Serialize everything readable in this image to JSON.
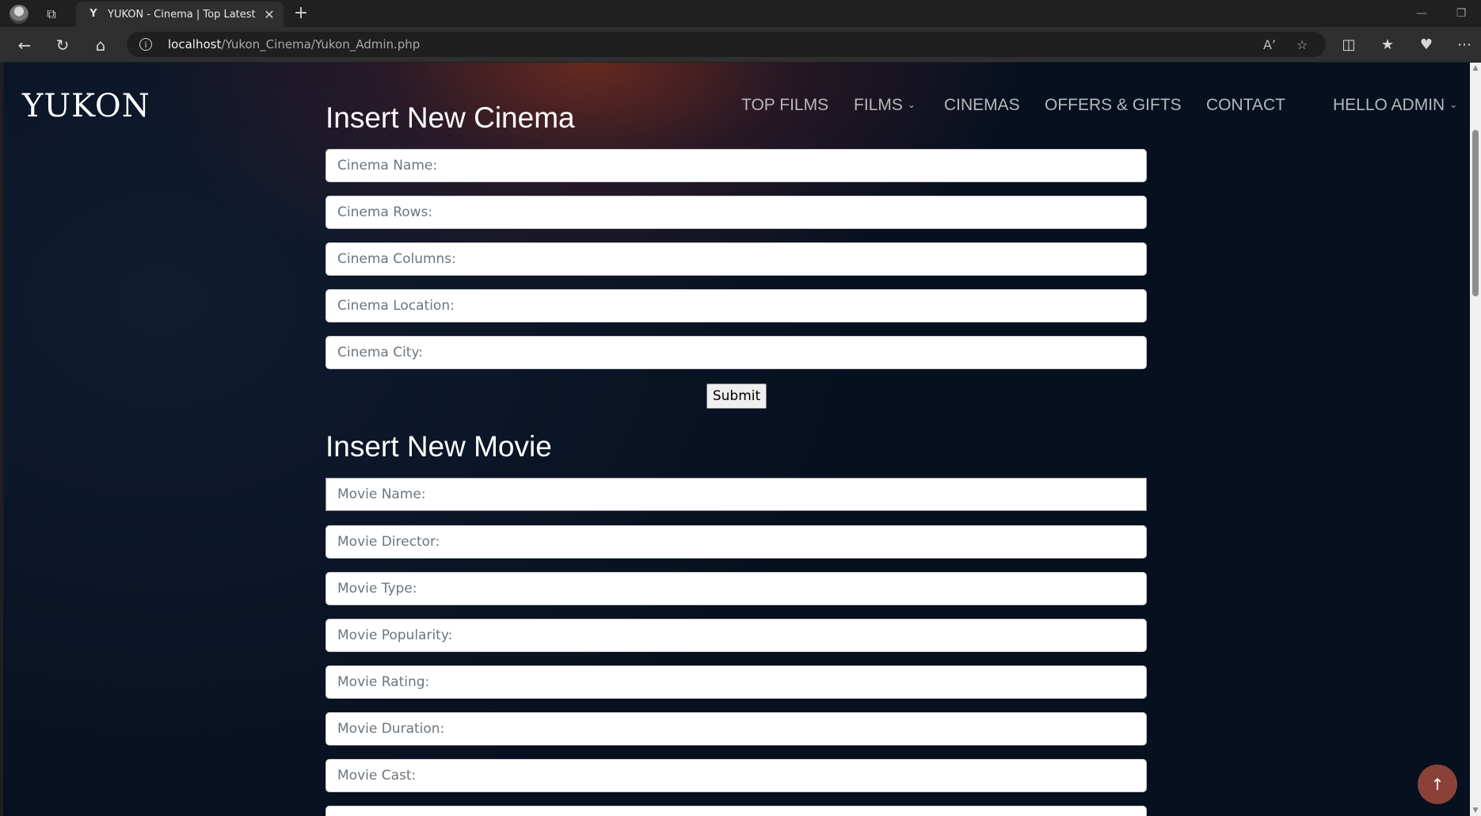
{
  "browser": {
    "tab_title": "YUKON - Cinema | Top Latest Mo",
    "tab_favicon": "Y",
    "url_host": "localhost",
    "url_path": "/Yukon_Cinema/Yukon_Admin.php",
    "icons": [
      "profile-icon",
      "workspaces-icon",
      "close-tab-icon",
      "new-tab-icon",
      "back-icon",
      "refresh-icon",
      "home-icon",
      "site-info-icon",
      "read-aloud-icon",
      "favorite-star-icon",
      "split-screen-icon",
      "favorites-icon",
      "browser-essentials-icon",
      "more-menu-icon",
      "minimize-icon",
      "restore-icon"
    ]
  },
  "site": {
    "logo": "YUKON",
    "nav": {
      "top_films": "TOP FILMS",
      "films": "FILMS",
      "cinemas": "CINEMAS",
      "offers": "OFFERS & GIFTS",
      "contact": "CONTACT",
      "user": "HELLO ADMIN"
    }
  },
  "cinema_form": {
    "title": "Insert New Cinema",
    "fields": {
      "name": "Cinema Name:",
      "rows": "Cinema Rows:",
      "columns": "Cinema Columns:",
      "location": "Cinema Location:",
      "city": "Cinema City:"
    },
    "submit_label": "Submit"
  },
  "movie_form": {
    "title": "Insert New Movie",
    "fields": {
      "name": "Movie Name:",
      "director": "Movie Director:",
      "type": "Movie Type:",
      "popularity": "Movie Popularity:",
      "rating": "Movie Rating:",
      "duration": "Movie Duration:",
      "cast": "Movie Cast:"
    }
  },
  "colors": {
    "page_bg": "#06101f",
    "accent_glow": "#782d1e",
    "scroll_top_button": "#8a4238",
    "nav_text": "#b8b8b8"
  }
}
